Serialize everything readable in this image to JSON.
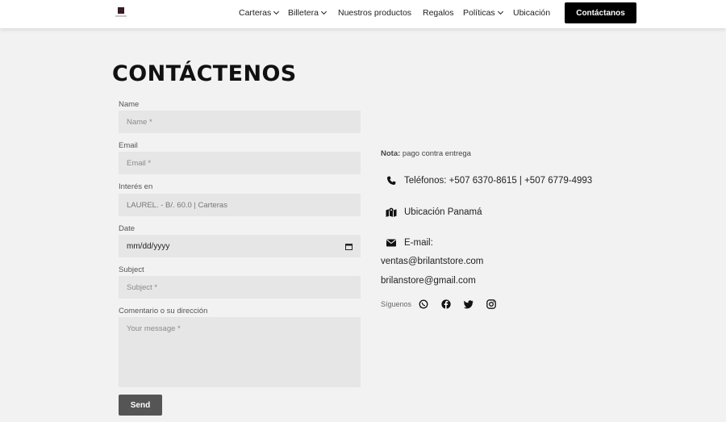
{
  "nav": {
    "items": [
      {
        "label": "Carteras",
        "dropdown": true
      },
      {
        "label": "Billetera",
        "dropdown": true
      },
      {
        "label": "Nuestros productos",
        "dropdown": false
      },
      {
        "label": "Regalos",
        "dropdown": false
      },
      {
        "label": "Políticas",
        "dropdown": true
      },
      {
        "label": "Ubicación",
        "dropdown": false
      }
    ],
    "cta_label": "Contáctanos"
  },
  "page": {
    "title": "CONTÁCTENOS"
  },
  "form": {
    "name_label": "Name",
    "name_placeholder": "Name *",
    "email_label": "Email",
    "email_placeholder": "Email *",
    "interest_label": "Interés en",
    "interest_value": "LAUREL. - B/. 60.0 | Carteras",
    "date_label": "Date",
    "date_value": "mm/dd/yyyy",
    "subject_label": "Subject",
    "subject_placeholder": "Subject *",
    "comment_label": "Comentario o su dirección",
    "message_placeholder": "Your message *",
    "send_label": "Send"
  },
  "contact": {
    "note_label": "Nota:",
    "note_text": " pago contra entrega",
    "phones": "Teléfonos: +507 6370-8615 | +507 6779-4993",
    "location": "Ubicación Panamá",
    "email_label": "E-mail:",
    "email_1": "ventas@brilantstore.com",
    "email_2": "brilanstore@gmail.com",
    "follow_label": "Síguenos",
    "socials": [
      "whatsapp-icon",
      "facebook-icon",
      "twitter-icon",
      "instagram-icon"
    ]
  },
  "colors": {
    "background": "#f2f2f2",
    "input_bg": "#e6e6e6",
    "cta_bg": "#000000",
    "send_bg": "#555555"
  }
}
